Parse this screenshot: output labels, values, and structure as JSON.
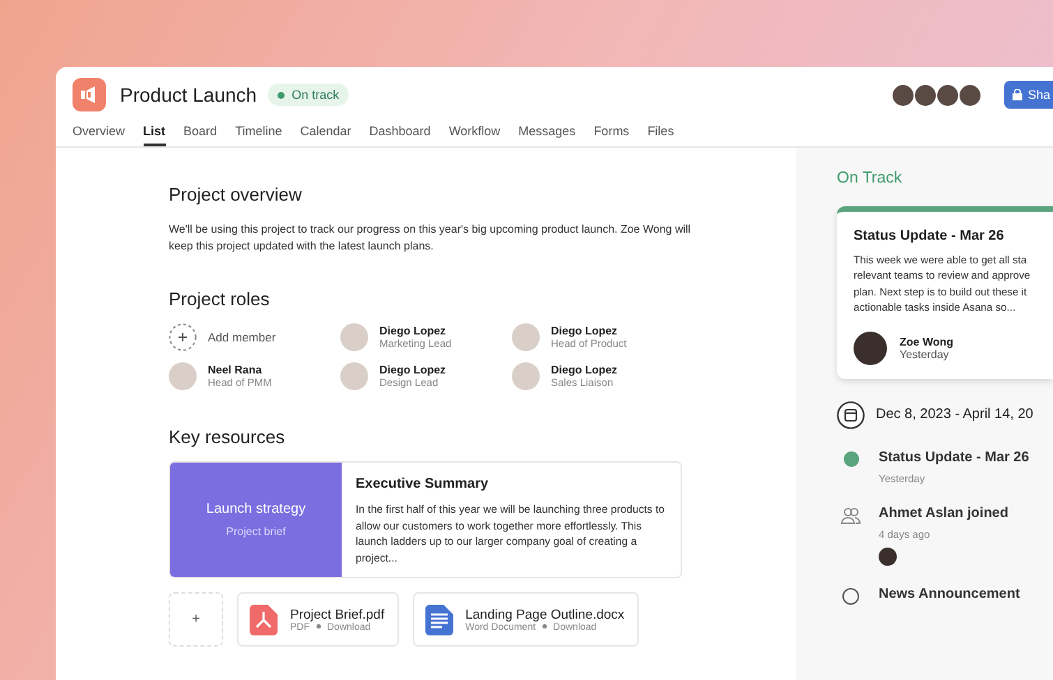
{
  "project": {
    "title": "Product Launch",
    "status": "On track"
  },
  "tabs": [
    {
      "label": "Overview",
      "selected": false
    },
    {
      "label": "List",
      "selected": true
    },
    {
      "label": "Board",
      "selected": false
    },
    {
      "label": "Timeline",
      "selected": false
    },
    {
      "label": "Calendar",
      "selected": false
    },
    {
      "label": "Dashboard",
      "selected": false
    },
    {
      "label": "Workflow",
      "selected": false
    },
    {
      "label": "Messages",
      "selected": false
    },
    {
      "label": "Forms",
      "selected": false
    },
    {
      "label": "Files",
      "selected": false
    }
  ],
  "share_button": "Sha",
  "overview": {
    "heading": "Project overview",
    "text": "We'll be using this project to track our progress on this year's big upcoming product launch. Zoe Wong will keep this project updated with the latest launch plans."
  },
  "roles": {
    "heading": "Project roles",
    "add_label": "Add member",
    "members": [
      {
        "name": "Diego Lopez",
        "role": "Marketing Lead"
      },
      {
        "name": "Diego Lopez",
        "role": "Head of Product"
      },
      {
        "name": "Neel Rana",
        "role": "Head of PMM"
      },
      {
        "name": "Diego Lopez",
        "role": "Design Lead"
      },
      {
        "name": "Diego Lopez",
        "role": "Sales Liaison"
      }
    ]
  },
  "resources": {
    "heading": "Key resources",
    "cover_title": "Launch strategy",
    "cover_subtitle": "Project brief",
    "summary_title": "Executive Summary",
    "summary_text": "In the first half of this year we will be launching three products to allow our customers to work together more effortlessly. This launch ladders up to our larger company goal of creating a project...",
    "add_label": "+",
    "files": [
      {
        "kind": "pdf",
        "name": "Project Brief.pdf",
        "type": "PDF",
        "action": "Download"
      },
      {
        "kind": "doc",
        "name": "Landing Page Outline.docx",
        "type": "Word Document",
        "action": "Download"
      }
    ]
  },
  "status_panel": {
    "heading": "On Track",
    "card_title": "Status Update - Mar 26",
    "card_lines": [
      "This week we were able to get all sta",
      "relevant teams to review and approve",
      "plan. Next step is to build out these it",
      "actionable tasks inside Asana so..."
    ],
    "author": "Zoe Wong",
    "time": "Yesterday",
    "date_range": "Dec 8, 2023 - April 14, 20",
    "timeline": [
      {
        "kind": "status",
        "title": "Status Update - Mar 26",
        "time": "Yesterday"
      },
      {
        "kind": "joined",
        "title": "Ahmet Aslan joined",
        "time": "4 days ago"
      },
      {
        "kind": "message",
        "title": "News Announcement"
      }
    ]
  }
}
